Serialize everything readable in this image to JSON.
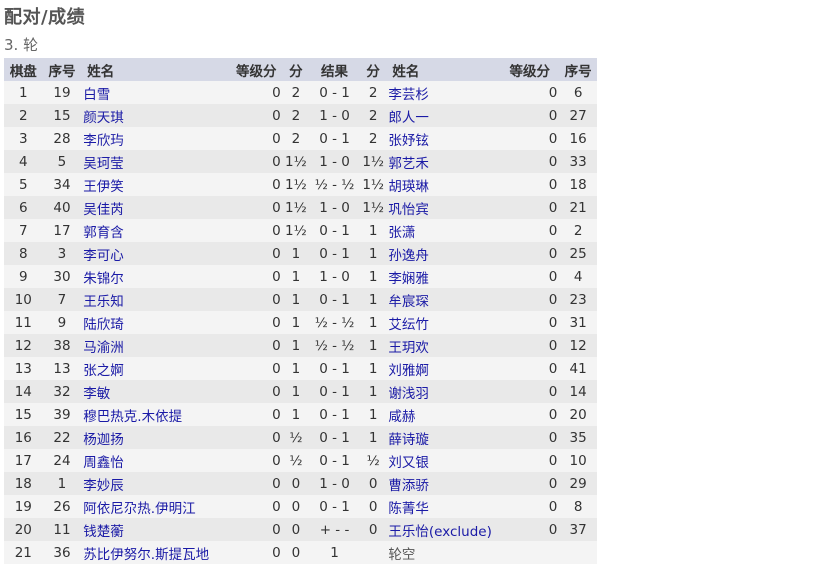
{
  "page": {
    "title": "配对/成绩",
    "round": "3. 轮"
  },
  "headers": {
    "board": "棋盘",
    "no": "序号",
    "name": "姓名",
    "rating": "等级分",
    "points": "分",
    "result": "结果",
    "points2": "分",
    "name2": "姓名",
    "rating2": "等级分",
    "no2": "序号"
  },
  "rows": [
    {
      "board": "1",
      "wno": "19",
      "wname": "白雪",
      "wrating": "0",
      "wpts": "2",
      "result": "0 - 1",
      "bpts": "2",
      "bname": "李芸杉",
      "brating": "0",
      "bno": "6"
    },
    {
      "board": "2",
      "wno": "15",
      "wname": "颜天琪",
      "wrating": "0",
      "wpts": "2",
      "result": "1 - 0",
      "bpts": "2",
      "bname": "郎人一",
      "brating": "0",
      "bno": "27"
    },
    {
      "board": "3",
      "wno": "28",
      "wname": "李欣玙",
      "wrating": "0",
      "wpts": "2",
      "result": "0 - 1",
      "bpts": "2",
      "bname": "张妤铉",
      "brating": "0",
      "bno": "16"
    },
    {
      "board": "4",
      "wno": "5",
      "wname": "吴珂莹",
      "wrating": "0",
      "wpts": "1½",
      "result": "1 - 0",
      "bpts": "1½",
      "bname": "郭艺禾",
      "brating": "0",
      "bno": "33"
    },
    {
      "board": "5",
      "wno": "34",
      "wname": "王伊笑",
      "wrating": "0",
      "wpts": "1½",
      "result": "½ - ½",
      "bpts": "1½",
      "bname": "胡瑛琳",
      "brating": "0",
      "bno": "18"
    },
    {
      "board": "6",
      "wno": "40",
      "wname": "吴佳芮",
      "wrating": "0",
      "wpts": "1½",
      "result": "1 - 0",
      "bpts": "1½",
      "bname": "巩怡宾",
      "brating": "0",
      "bno": "21"
    },
    {
      "board": "7",
      "wno": "17",
      "wname": "郭育含",
      "wrating": "0",
      "wpts": "1½",
      "result": "0 - 1",
      "bpts": "1",
      "bname": "张潇",
      "brating": "0",
      "bno": "2"
    },
    {
      "board": "8",
      "wno": "3",
      "wname": "李可心",
      "wrating": "0",
      "wpts": "1",
      "result": "0 - 1",
      "bpts": "1",
      "bname": "孙逸舟",
      "brating": "0",
      "bno": "25"
    },
    {
      "board": "9",
      "wno": "30",
      "wname": "朱锦尔",
      "wrating": "0",
      "wpts": "1",
      "result": "1 - 0",
      "bpts": "1",
      "bname": "李娴雅",
      "brating": "0",
      "bno": "4"
    },
    {
      "board": "10",
      "wno": "7",
      "wname": "王乐知",
      "wrating": "0",
      "wpts": "1",
      "result": "0 - 1",
      "bpts": "1",
      "bname": "牟宸琛",
      "brating": "0",
      "bno": "23"
    },
    {
      "board": "11",
      "wno": "9",
      "wname": "陆欣琦",
      "wrating": "0",
      "wpts": "1",
      "result": "½ - ½",
      "bpts": "1",
      "bname": "艾纭竹",
      "brating": "0",
      "bno": "31"
    },
    {
      "board": "12",
      "wno": "38",
      "wname": "马渝洲",
      "wrating": "0",
      "wpts": "1",
      "result": "½ - ½",
      "bpts": "1",
      "bname": "王玥欢",
      "brating": "0",
      "bno": "12"
    },
    {
      "board": "13",
      "wno": "13",
      "wname": "张之婀",
      "wrating": "0",
      "wpts": "1",
      "result": "0 - 1",
      "bpts": "1",
      "bname": "刘雅婀",
      "brating": "0",
      "bno": "41"
    },
    {
      "board": "14",
      "wno": "32",
      "wname": "李敏",
      "wrating": "0",
      "wpts": "1",
      "result": "0 - 1",
      "bpts": "1",
      "bname": "谢浅羽",
      "brating": "0",
      "bno": "14"
    },
    {
      "board": "15",
      "wno": "39",
      "wname": "穆巴热克.木依提",
      "wrating": "0",
      "wpts": "1",
      "result": "0 - 1",
      "bpts": "1",
      "bname": "咸赫",
      "brating": "0",
      "bno": "20"
    },
    {
      "board": "16",
      "wno": "22",
      "wname": "杨迦扬",
      "wrating": "0",
      "wpts": "½",
      "result": "0 - 1",
      "bpts": "1",
      "bname": "薛诗璇",
      "brating": "0",
      "bno": "35"
    },
    {
      "board": "17",
      "wno": "24",
      "wname": "周鑫怡",
      "wrating": "0",
      "wpts": "½",
      "result": "0 - 1",
      "bpts": "½",
      "bname": "刘又银",
      "brating": "0",
      "bno": "10"
    },
    {
      "board": "18",
      "wno": "1",
      "wname": "李妙辰",
      "wrating": "0",
      "wpts": "0",
      "result": "1 - 0",
      "bpts": "0",
      "bname": "曹添骄",
      "brating": "0",
      "bno": "29"
    },
    {
      "board": "19",
      "wno": "26",
      "wname": "阿依尼尕热.伊明江",
      "wrating": "0",
      "wpts": "0",
      "result": "0 - 1",
      "bpts": "0",
      "bname": "陈菁华",
      "brating": "0",
      "bno": "8"
    },
    {
      "board": "20",
      "wno": "11",
      "wname": "钱楚蘅",
      "wrating": "0",
      "wpts": "0",
      "result": "+ - -",
      "bpts": "0",
      "bname": "王乐怡(exclude)",
      "brating": "0",
      "bno": "37"
    },
    {
      "board": "21",
      "wno": "36",
      "wname": "苏比伊努尔.斯提瓦地",
      "wrating": "0",
      "wpts": "0",
      "result": "1",
      "bpts": "",
      "bname": "轮空",
      "brating": "",
      "bno": ""
    }
  ]
}
